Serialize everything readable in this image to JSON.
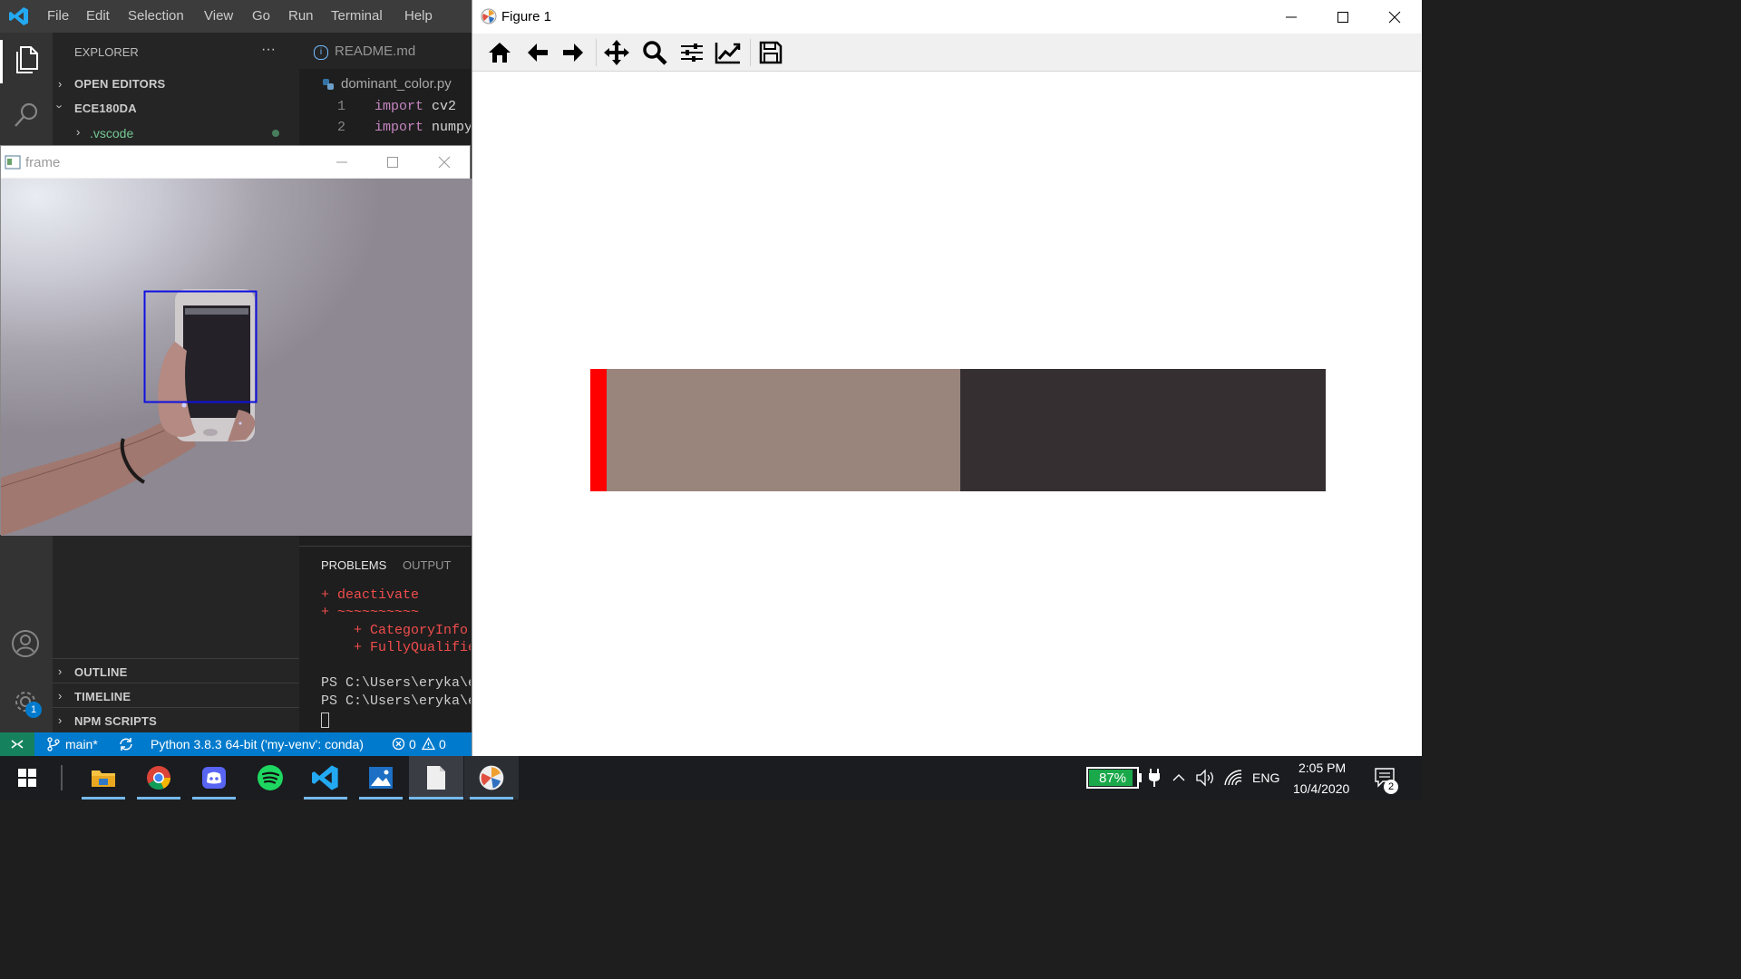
{
  "vscode": {
    "menu": [
      "File",
      "Edit",
      "Selection",
      "View",
      "Go",
      "Run",
      "Terminal",
      "Help"
    ],
    "explorer": {
      "title": "EXPLORER",
      "more": "···",
      "open_editors": "OPEN EDITORS",
      "folder": "ECE180DA",
      "vscode_folder": ".vscode",
      "outline": "OUTLINE",
      "timeline": "TIMELINE",
      "npm_scripts": "NPM SCRIPTS"
    },
    "tabs": {
      "readme": "README.md"
    },
    "breadcrumb": "dominant_color.py",
    "code": [
      {
        "num": "1",
        "kw": "import",
        "rest": " cv2"
      },
      {
        "num": "2",
        "kw": "import",
        "rest": " numpy"
      }
    ],
    "panel": {
      "tab_problems": "PROBLEMS",
      "tab_output": "OUTPUT",
      "lines_red": [
        "+ deactivate",
        "+ ~~~~~~~~~~",
        "    + CategoryInfo",
        "    + FullyQualifie"
      ],
      "prompt1": "PS C:\\Users\\eryka\\e",
      "prompt2": "PS C:\\Users\\eryka\\e"
    },
    "status": {
      "branch": "main*",
      "python": "Python 3.8.3 64-bit ('my-venv': conda)",
      "errors": "0",
      "warnings": "0",
      "settings_badge": "1"
    }
  },
  "frame_window": {
    "title": "frame"
  },
  "figure_window": {
    "title": "Figure 1",
    "bar_segments": [
      {
        "color": "#ff0000",
        "fraction": 0.022
      },
      {
        "color": "#9a857c",
        "fraction": 0.481
      },
      {
        "color": "#362f31",
        "fraction": 0.497
      }
    ]
  },
  "taskbar": {
    "battery": "87%",
    "lang": "ENG",
    "time": "2:05 PM",
    "date": "10/4/2020",
    "notif_count": "2"
  }
}
